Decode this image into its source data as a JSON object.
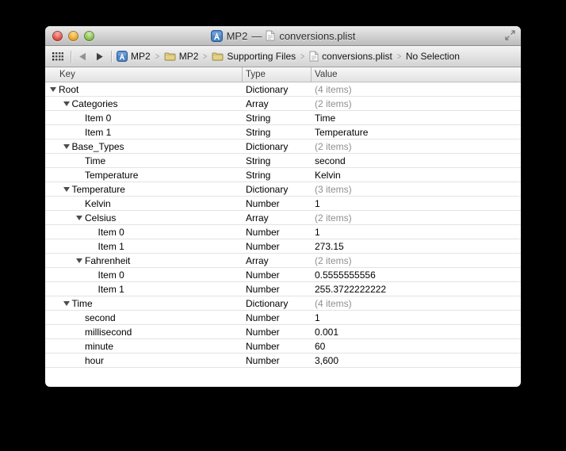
{
  "window": {
    "title_project": "MP2",
    "title_separator": "—",
    "title_document": "conversions.plist"
  },
  "toolbar": {
    "breadcrumb": [
      {
        "icon": "project",
        "label": "MP2"
      },
      {
        "icon": "folder",
        "label": "MP2"
      },
      {
        "icon": "folder",
        "label": "Supporting Files"
      },
      {
        "icon": "plist",
        "label": "conversions.plist"
      },
      {
        "icon": null,
        "label": "No Selection"
      }
    ]
  },
  "table": {
    "columns": [
      "Key",
      "Type",
      "Value"
    ],
    "rows": [
      {
        "indent": 0,
        "disclosure": true,
        "key": "Root",
        "type": "Dictionary",
        "value": "(4 items)",
        "value_muted": true
      },
      {
        "indent": 1,
        "disclosure": true,
        "key": "Categories",
        "type": "Array",
        "value": "(2 items)",
        "value_muted": true
      },
      {
        "indent": 2,
        "disclosure": false,
        "key": "Item 0",
        "type": "String",
        "value": "Time"
      },
      {
        "indent": 2,
        "disclosure": false,
        "key": "Item 1",
        "type": "String",
        "value": "Temperature"
      },
      {
        "indent": 1,
        "disclosure": true,
        "key": "Base_Types",
        "type": "Dictionary",
        "value": "(2 items)",
        "value_muted": true
      },
      {
        "indent": 2,
        "disclosure": false,
        "key": "Time",
        "type": "String",
        "value": "second"
      },
      {
        "indent": 2,
        "disclosure": false,
        "key": "Temperature",
        "type": "String",
        "value": "Kelvin"
      },
      {
        "indent": 1,
        "disclosure": true,
        "key": "Temperature",
        "type": "Dictionary",
        "value": "(3 items)",
        "value_muted": true
      },
      {
        "indent": 2,
        "disclosure": false,
        "key": "Kelvin",
        "type": "Number",
        "value": "1"
      },
      {
        "indent": 2,
        "disclosure": true,
        "key": "Celsius",
        "type": "Array",
        "value": "(2 items)",
        "value_muted": true
      },
      {
        "indent": 3,
        "disclosure": false,
        "key": "Item 0",
        "type": "Number",
        "value": "1"
      },
      {
        "indent": 3,
        "disclosure": false,
        "key": "Item 1",
        "type": "Number",
        "value": "273.15"
      },
      {
        "indent": 2,
        "disclosure": true,
        "key": "Fahrenheit",
        "type": "Array",
        "value": "(2 items)",
        "value_muted": true
      },
      {
        "indent": 3,
        "disclosure": false,
        "key": "Item 0",
        "type": "Number",
        "value": "0.5555555556"
      },
      {
        "indent": 3,
        "disclosure": false,
        "key": "Item 1",
        "type": "Number",
        "value": "255.3722222222"
      },
      {
        "indent": 1,
        "disclosure": true,
        "key": "Time",
        "type": "Dictionary",
        "value": "(4 items)",
        "value_muted": true
      },
      {
        "indent": 2,
        "disclosure": false,
        "key": "second",
        "type": "Number",
        "value": "1"
      },
      {
        "indent": 2,
        "disclosure": false,
        "key": "millisecond",
        "type": "Number",
        "value": "0.001"
      },
      {
        "indent": 2,
        "disclosure": false,
        "key": "minute",
        "type": "Number",
        "value": "60"
      },
      {
        "indent": 2,
        "disclosure": false,
        "key": "hour",
        "type": "Number",
        "value": "3,600"
      }
    ]
  },
  "colors": {
    "project_blue": "#4c84c3",
    "folder_yellow": "#e2d08b",
    "muted_value_gray": "#8f8f8f",
    "titlebar_top": "#eaeaea",
    "titlebar_bottom": "#bcbcbc"
  }
}
